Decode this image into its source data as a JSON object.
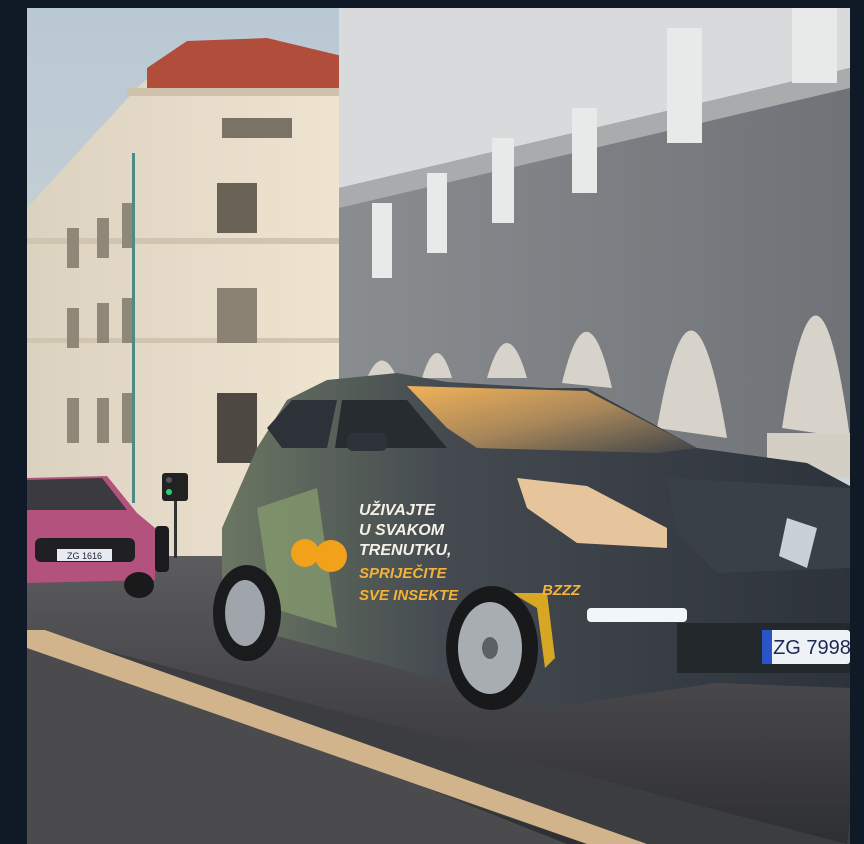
{
  "photo": {
    "colors": {
      "frame_background": "#0f1a26",
      "sky": "#c7d3db",
      "car_body": "#3b4148",
      "mini_body": "#b3527c",
      "road_line": "#d1b48b"
    },
    "car_wrap": {
      "slogan_lines": [
        "UŽIVAJTE",
        "U SVAKOM",
        "TRENUTKU,",
        "SPRIJEČITE",
        "SVE INSEKTE"
      ],
      "badge": "BZZZ"
    },
    "plates": {
      "renault": "ZG 7998",
      "mini": "ZG 1616"
    }
  }
}
